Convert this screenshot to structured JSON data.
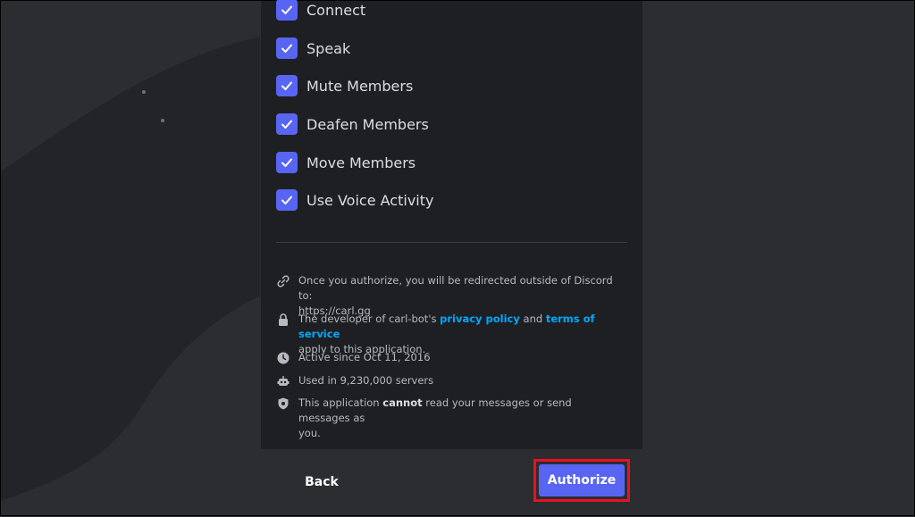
{
  "permissions": [
    {
      "label": "Connect",
      "checked": true
    },
    {
      "label": "Speak",
      "checked": true
    },
    {
      "label": "Mute Members",
      "checked": true
    },
    {
      "label": "Deafen Members",
      "checked": true
    },
    {
      "label": "Move Members",
      "checked": true
    },
    {
      "label": "Use Voice Activity",
      "checked": true
    }
  ],
  "info": {
    "redirect": {
      "icon": "link-icon",
      "line1": "Once you authorize, you will be redirected outside of Discord to:",
      "line2": "https://carl.gg"
    },
    "policy": {
      "icon": "lock-icon",
      "prefix": "The developer of carl-bot's ",
      "privacy_link": "privacy policy",
      "and": " and ",
      "terms_link": "terms of service",
      "suffix": "apply to this application."
    },
    "active": {
      "icon": "clock-icon",
      "text": "Active since Oct 11, 2016"
    },
    "used": {
      "icon": "robot-icon",
      "text": "Used in 9,230,000 servers"
    },
    "privacy": {
      "icon": "shield-icon",
      "prefix": "This application ",
      "bold": "cannot",
      "suffix": " read your messages or send messages as",
      "line2": "you."
    }
  },
  "footer": {
    "back_label": "Back",
    "authorize_label": "Authorize"
  },
  "colors": {
    "accent": "#5865f2",
    "link": "#00a8fc",
    "highlight": "#e81123",
    "modal_bg": "#1e1f22",
    "page_bg": "#2b2d31"
  }
}
